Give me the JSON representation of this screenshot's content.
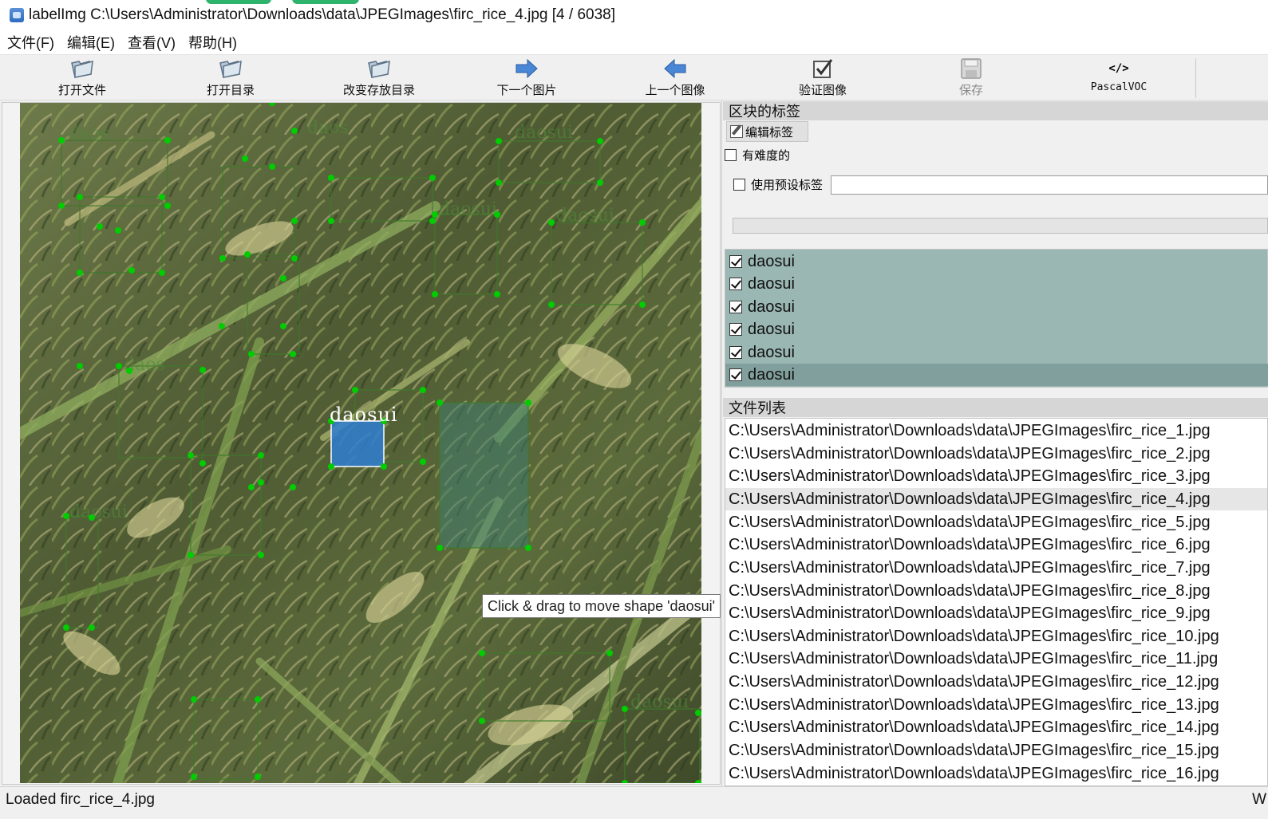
{
  "window": {
    "title": "labelImg C:\\Users\\Administrator\\Downloads\\data\\JPEGImages\\firc_rice_4.jpg [4 / 6038]"
  },
  "menu": [
    "文件(F)",
    "编辑(E)",
    "查看(V)",
    "帮助(H)"
  ],
  "toolbar": {
    "open_file": "打开文件",
    "open_dir": "打开目录",
    "change_save_dir": "改变存放目录",
    "next_image": "下一个图片",
    "prev_image": "上一个图像",
    "verify_image": "验证图像",
    "save": "保存",
    "format": "PascalVOC",
    "format_icon_text": "</>"
  },
  "canvas": {
    "selected_box_label": "daosui",
    "tooltip": "Click & drag to move shape 'daosui'"
  },
  "right_panel": {
    "box_labels_title": "区块的标签",
    "edit_label_button": "编辑标签",
    "difficult_label": "有难度的",
    "use_default_label": "使用预设标签",
    "default_label_value": "",
    "labels": [
      {
        "text": "daosui",
        "checked": true
      },
      {
        "text": "daosui",
        "checked": true
      },
      {
        "text": "daosui",
        "checked": true
      },
      {
        "text": "daosui",
        "checked": true
      },
      {
        "text": "daosui",
        "checked": true
      },
      {
        "text": "daosui",
        "checked": true
      }
    ],
    "file_list_title": "文件列表",
    "files": [
      "C:\\Users\\Administrator\\Downloads\\data\\JPEGImages\\firc_rice_1.jpg",
      "C:\\Users\\Administrator\\Downloads\\data\\JPEGImages\\firc_rice_2.jpg",
      "C:\\Users\\Administrator\\Downloads\\data\\JPEGImages\\firc_rice_3.jpg",
      "C:\\Users\\Administrator\\Downloads\\data\\JPEGImages\\firc_rice_4.jpg",
      "C:\\Users\\Administrator\\Downloads\\data\\JPEGImages\\firc_rice_5.jpg",
      "C:\\Users\\Administrator\\Downloads\\data\\JPEGImages\\firc_rice_6.jpg",
      "C:\\Users\\Administrator\\Downloads\\data\\JPEGImages\\firc_rice_7.jpg",
      "C:\\Users\\Administrator\\Downloads\\data\\JPEGImages\\firc_rice_8.jpg",
      "C:\\Users\\Administrator\\Downloads\\data\\JPEGImages\\firc_rice_9.jpg",
      "C:\\Users\\Administrator\\Downloads\\data\\JPEGImages\\firc_rice_10.jpg",
      "C:\\Users\\Administrator\\Downloads\\data\\JPEGImages\\firc_rice_11.jpg",
      "C:\\Users\\Administrator\\Downloads\\data\\JPEGImages\\firc_rice_12.jpg",
      "C:\\Users\\Administrator\\Downloads\\data\\JPEGImages\\firc_rice_13.jpg",
      "C:\\Users\\Administrator\\Downloads\\data\\JPEGImages\\firc_rice_14.jpg",
      "C:\\Users\\Administrator\\Downloads\\data\\JPEGImages\\firc_rice_15.jpg",
      "C:\\Users\\Administrator\\Downloads\\data\\JPEGImages\\firc_rice_16.jpg"
    ],
    "selected_file_index": 3
  },
  "status": {
    "message": "Loaded firc_rice_4.jpg",
    "right_text": "W"
  },
  "colors": {
    "label_list_bg": "#9ab7b4",
    "label_selected_bg": "#81a09d",
    "box_vertex": "#00cc00",
    "selected_box_fill": "#2f7fd1"
  },
  "icons": {
    "app": "labelimg-app-icon",
    "open_file": "folder-open-icon",
    "open_dir": "folder-open-icon",
    "change_save_dir": "folder-open-icon",
    "next_image": "arrow-right-icon",
    "prev_image": "arrow-left-icon",
    "verify_image": "checkbox-verify-icon",
    "save": "floppy-disk-icon",
    "format": "code-icon",
    "edit_label": "pencil-icon"
  }
}
